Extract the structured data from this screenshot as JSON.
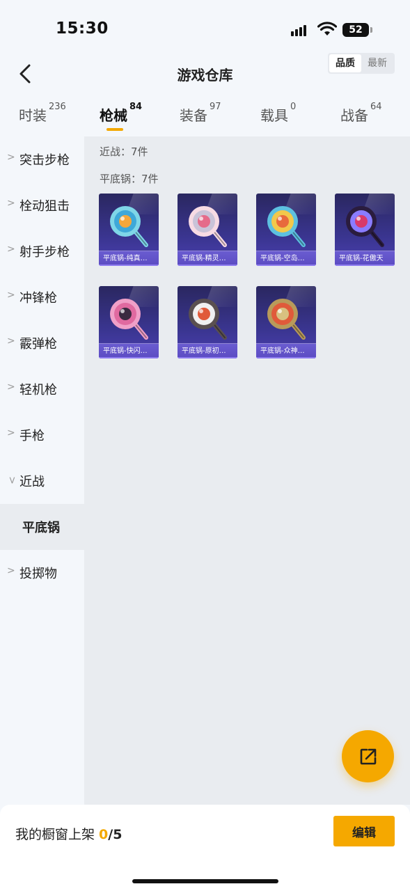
{
  "status": {
    "time": "15:30",
    "battery": "52"
  },
  "header": {
    "title": "游戏仓库",
    "sort_options": [
      "品质",
      "最新"
    ],
    "sort_selected": "品质"
  },
  "tabs": [
    {
      "label": "时装",
      "count": "236"
    },
    {
      "label": "枪械",
      "count": "84"
    },
    {
      "label": "装备",
      "count": "97"
    },
    {
      "label": "载具",
      "count": "0"
    },
    {
      "label": "战备",
      "count": "64"
    }
  ],
  "active_tab": "枪械",
  "sidebar": [
    {
      "label": "突击步枪"
    },
    {
      "label": "栓动狙击"
    },
    {
      "label": "射手步枪"
    },
    {
      "label": "冲锋枪"
    },
    {
      "label": "霰弹枪"
    },
    {
      "label": "轻机枪"
    },
    {
      "label": "手枪"
    },
    {
      "label": "近战"
    },
    {
      "label": "平底锅"
    },
    {
      "label": "投掷物"
    }
  ],
  "groups": {
    "melee": "近战：7件",
    "pan": "平底锅：7件"
  },
  "items": [
    {
      "caption": "平底锅-纯真…",
      "colors": [
        "#7fd6e8",
        "#f4a73a",
        "#3ea8d8"
      ]
    },
    {
      "caption": "平底锅-精灵…",
      "colors": [
        "#f7dbe4",
        "#e56b8a",
        "#c9c3d8"
      ]
    },
    {
      "caption": "平底锅-空岛…",
      "colors": [
        "#5dc0e0",
        "#e86a3c",
        "#f2c84b"
      ]
    },
    {
      "caption": "平底锅-花傲天",
      "colors": [
        "#2a1c3e",
        "#d83a6a",
        "#8a7cff"
      ]
    },
    {
      "caption": "平底锅-快闪…",
      "colors": [
        "#f0a0c8",
        "#3a2a40",
        "#e06aa0"
      ]
    },
    {
      "caption": "平底锅-原初…",
      "colors": [
        "#5a5050",
        "#e05a3a",
        "#f0f0f0"
      ]
    },
    {
      "caption": "平底锅-众神…",
      "colors": [
        "#b89a5a",
        "#d8c080",
        "#e05a3a"
      ]
    }
  ],
  "bottom": {
    "label": "我的橱窗上架 ",
    "count": "0",
    "total": "/5",
    "edit": "编辑"
  },
  "accent": "#f5a800"
}
